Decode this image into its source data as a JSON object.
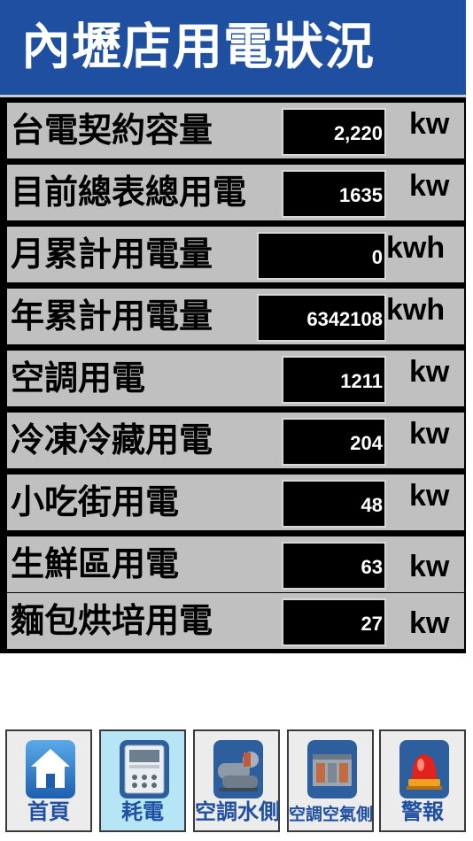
{
  "header": {
    "title": "內壢店用電狀況"
  },
  "rows": [
    {
      "label": "台電契約容量",
      "value": "2,220",
      "unit": "kw"
    },
    {
      "label": "目前總表總用電",
      "value": "1635",
      "unit": "kw"
    },
    {
      "label": "月累計用電量",
      "value": "0",
      "unit": "kwh"
    },
    {
      "label": "年累計用電量",
      "value": "6342108",
      "unit": "kwh"
    },
    {
      "label": "空調用電",
      "value": "1211",
      "unit": "kw"
    },
    {
      "label": "冷凍冷藏用電",
      "value": "204",
      "unit": "kw"
    },
    {
      "label": "小吃街用電",
      "value": "48",
      "unit": "kw"
    },
    {
      "label": "生鮮區用電",
      "value": "63",
      "unit": "kw"
    },
    {
      "label": "麵包烘培用電",
      "value": "27",
      "unit": "kw"
    }
  ],
  "nav": [
    {
      "label": "首頁",
      "icon": "home-icon",
      "active": false
    },
    {
      "label": "耗電",
      "icon": "power-meter-icon",
      "active": true
    },
    {
      "label": "空調水側",
      "icon": "chiller-icon",
      "active": false
    },
    {
      "label": "空調空氣側",
      "icon": "air-handler-icon",
      "active": false
    },
    {
      "label": "警報",
      "icon": "alarm-light-icon",
      "active": false
    }
  ],
  "colors": {
    "header_bg": "#1f4fa0",
    "nav_label": "#1f4fa0",
    "active_nav_bg": "#b6e6f6",
    "row_bg": "#c0c0c0"
  }
}
